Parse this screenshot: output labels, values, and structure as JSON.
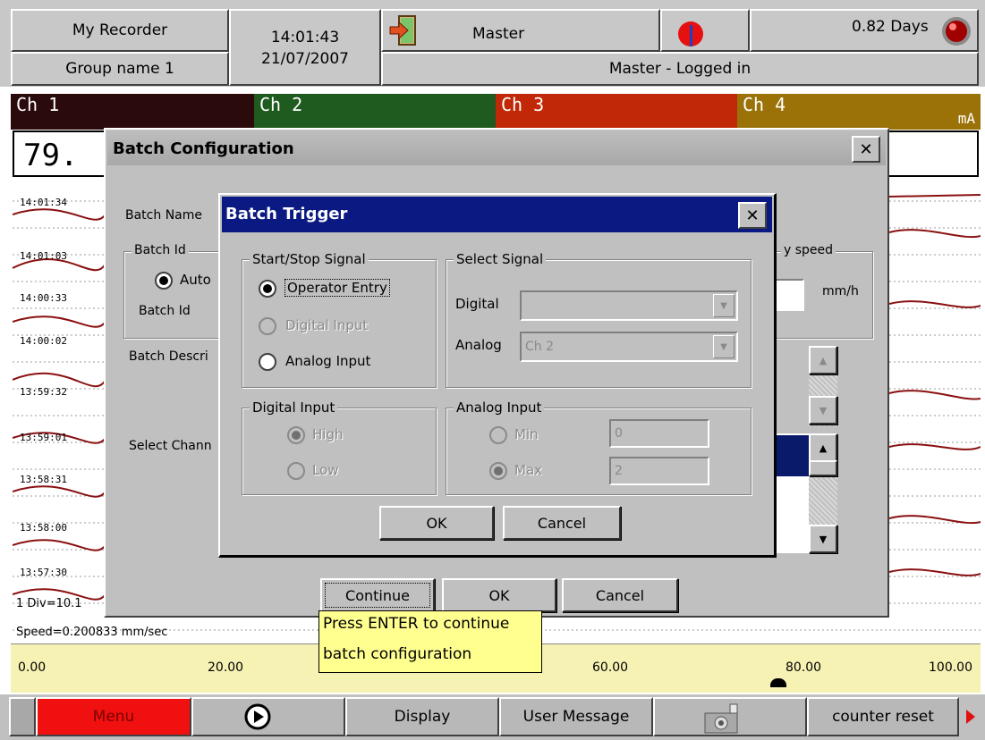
{
  "header": {
    "recorder_name": "My Recorder",
    "group_name": "Group name 1",
    "time": "14:01:43",
    "date": "21/07/2007",
    "user": "Master",
    "login_status": "Master - Logged in",
    "days_remaining": "0.82 Days"
  },
  "channels": [
    {
      "label": "Ch 1",
      "color": "#2a0a0a",
      "unit": ""
    },
    {
      "label": "Ch 2",
      "color": "#1f5a1f",
      "unit": ""
    },
    {
      "label": "Ch 3",
      "color": "#c02808",
      "unit": ""
    },
    {
      "label": "Ch 4",
      "color": "#9a7208",
      "unit": "mA"
    }
  ],
  "chart": {
    "value_readout": "79.",
    "time_labels": [
      "14:01:34",
      "14:01:03",
      "14:00:33",
      "14:00:02",
      "13:59:32",
      "13:59:01",
      "13:58:31",
      "13:58:00",
      "13:57:30"
    ],
    "div_label": "1 Div=10.1",
    "speed_label": "Speed=0.200833 mm/sec",
    "scale_ticks": [
      "0.00",
      "20.00",
      "60.00",
      "80.00",
      "100.00"
    ],
    "scale_marker_value": 80
  },
  "batch_config": {
    "title": "Batch Configuration",
    "batch_name_label": "Batch Name",
    "batch_id_group": "Batch Id",
    "auto_label": "Auto",
    "batch_id_label": "Batch Id",
    "batch_desc_label": "Batch Descri",
    "select_channel_label": "Select Chann",
    "speed_group": "y speed",
    "speed_unit": "mm/h",
    "continue_label": "Continue",
    "ok_label": "OK",
    "cancel_label": "Cancel",
    "tooltip_line1": "Press ENTER to continue",
    "tooltip_line2": "batch configuration"
  },
  "batch_trigger": {
    "title": "Batch Trigger",
    "start_stop_group": "Start/Stop Signal",
    "opt_operator": "Operator Entry",
    "opt_digital": "Digital Input",
    "opt_analog": "Analog Input",
    "select_signal_group": "Select Signal",
    "digital_label": "Digital",
    "digital_value": "",
    "analog_label": "Analog",
    "analog_value": "Ch 2",
    "digital_input_group": "Digital Input",
    "high_label": "High",
    "low_label": "Low",
    "analog_input_group": "Analog Input",
    "min_label": "Min",
    "max_label": "Max",
    "min_value": "0",
    "max_value": "2",
    "ok_label": "OK",
    "cancel_label": "Cancel"
  },
  "taskbar": {
    "menu_label": "Menu",
    "display_label": "Display",
    "user_message_label": "User Message",
    "counter_reset_label": "counter reset"
  }
}
